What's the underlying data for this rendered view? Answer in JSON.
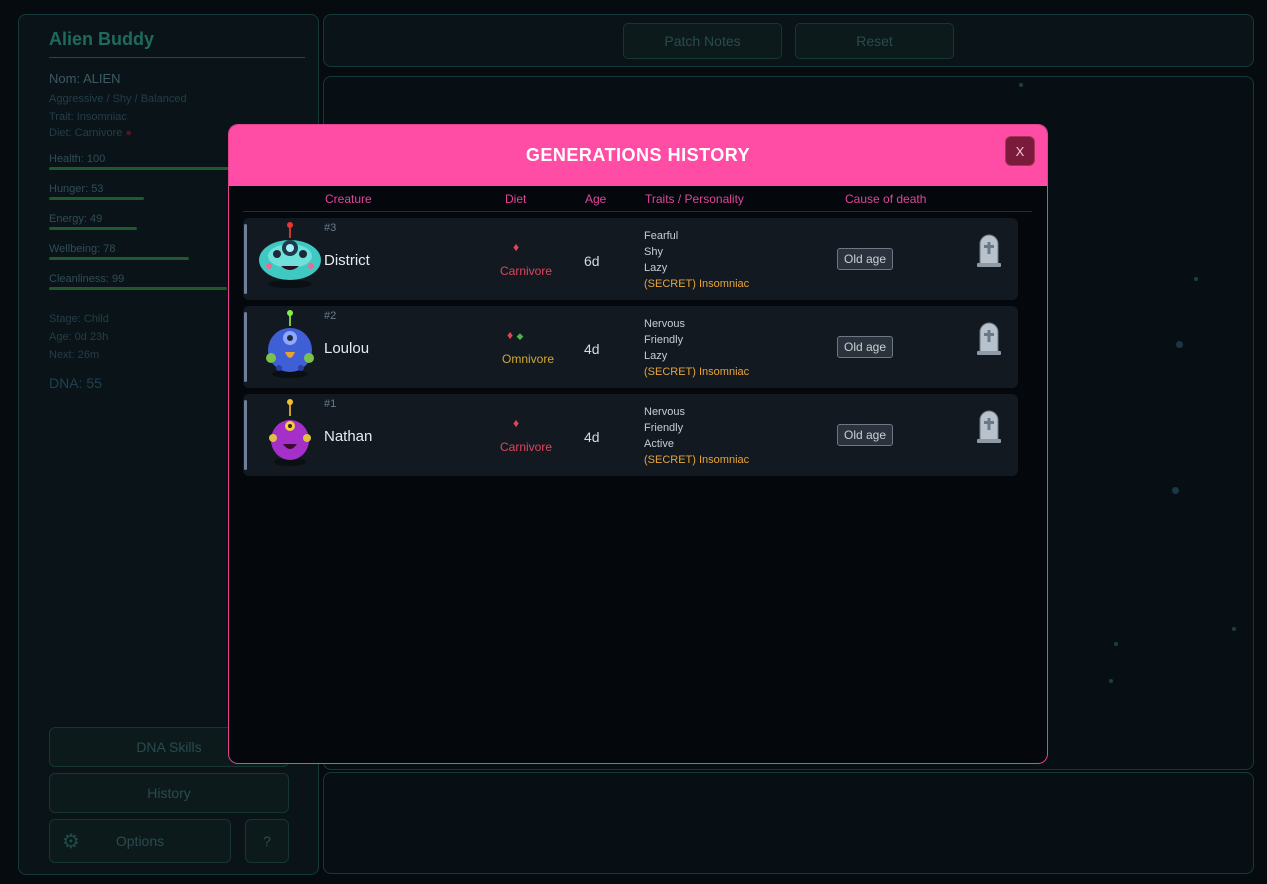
{
  "sidebar": {
    "app_title": "Alien Buddy",
    "name_line": "Nom: ALIEN",
    "personality_line": "Aggressive / Shy / Balanced",
    "trait_line": "Trait: Insomniac",
    "diet_line": "Diet: Carnivore",
    "stats": [
      {
        "label": "Health: 100",
        "value": 100
      },
      {
        "label": "Hunger: 53",
        "value": 53
      },
      {
        "label": "Energy: 49",
        "value": 49
      },
      {
        "label": "Wellbeing: 78",
        "value": 78
      },
      {
        "label": "Cleanliness: 99",
        "value": 99
      }
    ],
    "stage_line": "Stage: Child",
    "age_line": "Age: 0d 23h",
    "next_line": "Next: 26m",
    "dna_line": "DNA: 55",
    "dna_skills_label": "DNA Skills",
    "history_label": "History",
    "options_label": "Options",
    "help_label": "?"
  },
  "topbar": {
    "patch_notes_label": "Patch Notes",
    "reset_label": "Reset"
  },
  "modal": {
    "title": "GENERATIONS HISTORY",
    "close_label": "X",
    "columns": {
      "creature": "Creature",
      "diet": "Diet",
      "age": "Age",
      "traits": "Traits / Personality",
      "cause": "Cause of death"
    },
    "rows": [
      {
        "number": "#3",
        "name": "District",
        "diet": "Carnivore",
        "diet_color": "#e0455a",
        "age": "6d",
        "traits": [
          "Fearful",
          "Shy",
          "Lazy"
        ],
        "secret_trait": "(SECRET) Insomniac",
        "cause": "Old age",
        "avatar_color": "#3fc9c2"
      },
      {
        "number": "#2",
        "name": "Loulou",
        "diet": "Omnivore",
        "diet_color": "#d0a83a",
        "age": "4d",
        "traits": [
          "Nervous",
          "Friendly",
          "Lazy"
        ],
        "secret_trait": "(SECRET) Insomniac",
        "cause": "Old age",
        "avatar_color": "#3f5fd6"
      },
      {
        "number": "#1",
        "name": "Nathan",
        "diet": "Carnivore",
        "diet_color": "#e0455a",
        "age": "4d",
        "traits": [
          "Nervous",
          "Friendly",
          "Active"
        ],
        "secret_trait": "(SECRET) Insomniac",
        "cause": "Old age",
        "avatar_color": "#a42fc9"
      }
    ]
  },
  "colors": {
    "modal_header": "#ff4da6",
    "column_header": "#e0459a",
    "secret_trait": "#e7a43a"
  },
  "icons": [
    "meat-icon",
    "leaf-icon",
    "tombstone-icon",
    "gear-icon",
    "close-icon"
  ]
}
